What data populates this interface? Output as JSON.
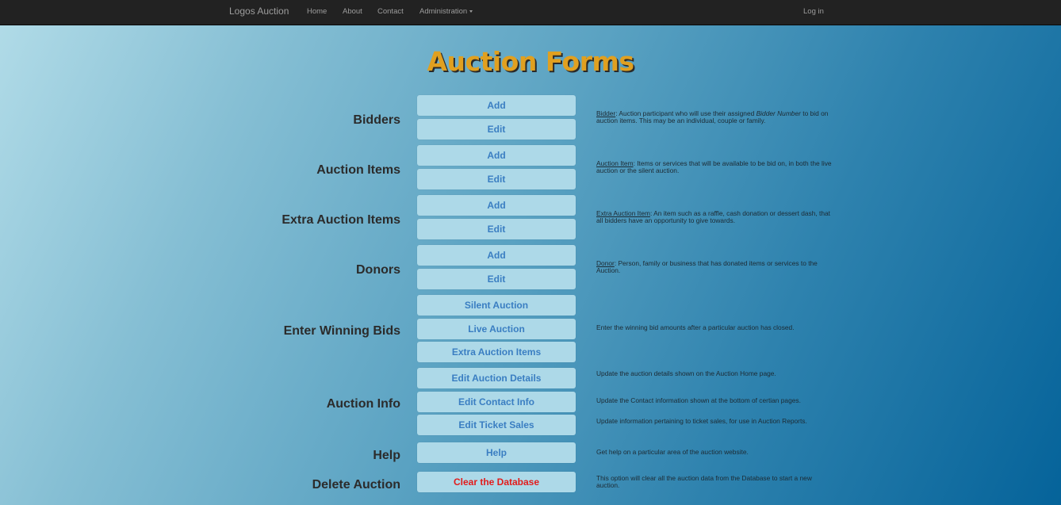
{
  "navbar": {
    "brand": "Logos Auction",
    "links": [
      "Home",
      "About",
      "Contact",
      "Administration"
    ],
    "login": "Log in"
  },
  "page": {
    "title": "Auction Forms"
  },
  "sections": {
    "bidders": {
      "label": "Bidders",
      "buttons": [
        "Add",
        "Edit"
      ],
      "desc": {
        "term": "Bidder",
        "pre": ": Auction participant who will use their assigned ",
        "em": "Bidder Number",
        "post": " to bid on auction items. This may be an individual, couple or family."
      }
    },
    "auction_items": {
      "label": "Auction Items",
      "buttons": [
        "Add",
        "Edit"
      ],
      "desc": {
        "term": "Auction Item",
        "text": ": Items or services that will be available to be bid on, in both the live auction or the silent auction."
      }
    },
    "extra_items": {
      "label": "Extra Auction Items",
      "buttons": [
        "Add",
        "Edit"
      ],
      "desc": {
        "term": "Extra Auction Item",
        "text": ": An item such as a raffle, cash donation or dessert dash, that all bidders have an opportunity to give towards."
      }
    },
    "donors": {
      "label": "Donors",
      "buttons": [
        "Add",
        "Edit"
      ],
      "desc": {
        "term": "Donor",
        "text": ": Person, family or business that has donated items or services to the Auction."
      }
    },
    "winning_bids": {
      "label": "Enter Winning Bids",
      "buttons": [
        "Silent Auction",
        "Live Auction",
        "Extra Auction Items"
      ],
      "desc": "Enter the winning bid amounts after a particular auction has closed."
    },
    "auction_info": {
      "label": "Auction Info",
      "buttons": [
        "Edit Auction Details",
        "Edit Contact Info",
        "Edit Ticket Sales"
      ],
      "descs": [
        "Update the auction details shown on the Auction Home page.",
        "Update the Contact information shown at the bottom of certian pages.",
        "Update information pertaining to ticket sales, for use in Auction Reports."
      ]
    },
    "help": {
      "label": "Help",
      "button": "Help",
      "desc": "Get help on a particular area of the auction website."
    },
    "delete": {
      "label": "Delete Auction",
      "button": "Clear the Database",
      "desc": "This option will clear all the auction data from the Database to start a new auction."
    }
  },
  "colors": {
    "title": "#e0a020",
    "button_bg": "#add9e8",
    "button_text": "#3a7ec2",
    "danger_text": "#e21b1b",
    "navbar": "#222222"
  }
}
